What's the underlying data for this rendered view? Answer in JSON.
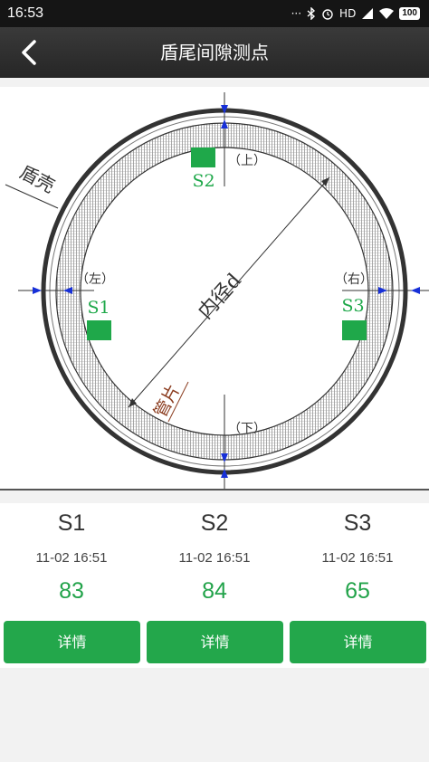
{
  "status_bar": {
    "time": "16:53",
    "network": "HD",
    "battery": "100"
  },
  "header": {
    "title": "盾尾间隙测点",
    "back_icon": "chevron-left-icon"
  },
  "diagram": {
    "label_shell": "盾壳",
    "label_segment": "管片",
    "label_diameter": "内径d",
    "label_top": "（上）",
    "label_bottom": "（下）",
    "label_left": "（左）",
    "label_right": "（右）",
    "sensor_s1": "S1",
    "sensor_s2": "S2",
    "sensor_s3": "S3",
    "marker_color": "#1fa84a"
  },
  "sensors": [
    {
      "name": "S1",
      "time": "11-02 16:51",
      "value": "83",
      "button": "详情"
    },
    {
      "name": "S2",
      "time": "11-02 16:51",
      "value": "84",
      "button": "详情"
    },
    {
      "name": "S3",
      "time": "11-02 16:51",
      "value": "65",
      "button": "详情"
    }
  ],
  "colors": {
    "accent_green": "#23a74b",
    "value_green": "#22a34a",
    "app_bar": "#2e2e2e"
  }
}
